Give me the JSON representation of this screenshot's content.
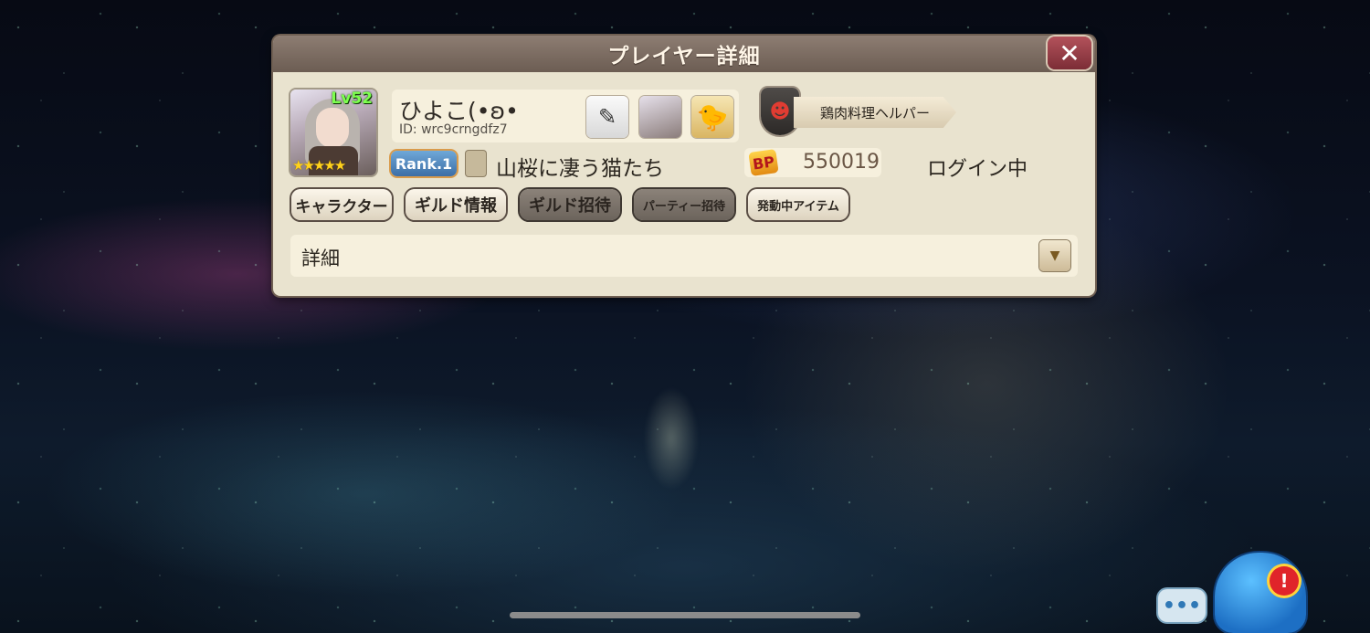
{
  "dialog": {
    "title": "プレイヤー詳細",
    "close_label": "✕"
  },
  "player": {
    "level": "Lv52",
    "rarity_stars": "★★★★★",
    "name": "ひよこ(•ʚ•",
    "id": "ID: wrc9crngdfz7",
    "rank": "Rank.1",
    "guild_name": "山桜に凄う猫たち",
    "title_badge": "鶏肉料理ヘルパー",
    "bp_icon": "BP",
    "bp_value": "550019",
    "status": "ログイン中"
  },
  "icons": {
    "edit": "pen-icon",
    "chick": "🐤",
    "shield": "devil-shield-icon"
  },
  "buttons": {
    "character": "キャラクター",
    "guild_info": "ギルド情報",
    "guild_invite": "ギルド招待",
    "party_invite": "パーティー招待",
    "active_items": "発動中アイテム"
  },
  "detail": {
    "label": "詳細",
    "toggle": "▼"
  },
  "overlay": {
    "chat": "•••",
    "alert": "!"
  }
}
